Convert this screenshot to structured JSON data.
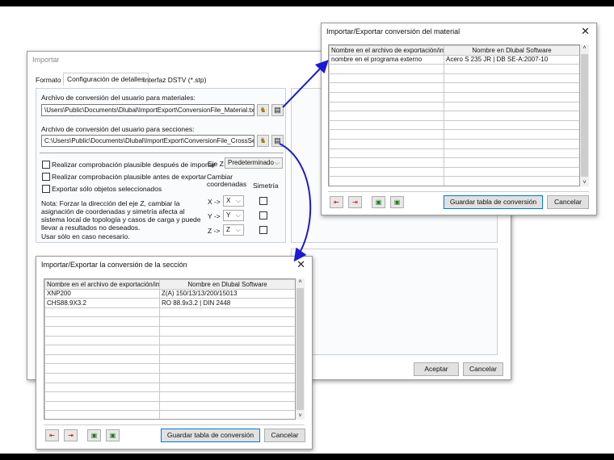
{
  "import_dialog": {
    "title": "Importar",
    "tabs": [
      "Formato",
      "Configuración de detalles",
      "Interfaz DSTV (*.stp)"
    ],
    "materials_label": "Archivo de conversión del usuario para materiales:",
    "materials_path": "\\Users\\Public\\Documents\\Dlubal\\ImportExport\\ConversionFile_Material.txt",
    "sections_label": "Archivo de conversión del usuario para secciones:",
    "sections_path": "C:\\Users\\Public\\Documents\\Dlubal\\ImportExport\\ConversionFile_CrossSect",
    "checks": [
      "Realizar comprobación plausible después de importar",
      "Realizar comprobación plausible antes de exportar",
      "Exportar sólo objetos seleccionados"
    ],
    "axis_z_label": "Eje Z:",
    "axis_z_value": "Predeterminado",
    "change_coords_label": "Cambiar coordenadas",
    "symmetry_label": "Simetría",
    "axes": [
      {
        "label": "X ->",
        "value": "X"
      },
      {
        "label": "Y ->",
        "value": "Y"
      },
      {
        "label": "Z ->",
        "value": "Z"
      }
    ],
    "note": "Nota: Forzar la dirección del eje Z, cambiar la asignación de coordenadas y simetría afecta al sistema local de topología y casos de carga y puede llevar a resultados no deseados.",
    "note2": "Usar sólo en caso necesario.",
    "ok": "Aceptar",
    "cancel": "Cancelar"
  },
  "material_dialog": {
    "title": "Importar/Exportar conversión del material",
    "columns": [
      "Nombre en el archivo de exportación/importación",
      "Nombre en Dlubal Software"
    ],
    "rows": [
      [
        "nombre en el programa externo",
        "Acero S 235 JR | DB SE-A:2007-10"
      ]
    ],
    "save": "Guardar tabla de conversión",
    "cancel": "Cancelar"
  },
  "section_dialog": {
    "title": "Importar/Exportar la conversión de la sección",
    "columns": [
      "Nombre en el archivo de exportación/importación",
      "Nombre en Dlubal Software"
    ],
    "rows": [
      [
        "XNP200",
        "Z(A) 150/13/13/200/15013"
      ],
      [
        "CHS88.9X3.2",
        "RO 88.9x3.2 | DIN 2448"
      ]
    ],
    "save": "Guardar tabla de conversión",
    "cancel": "Cancelar"
  },
  "colors": {
    "arrow": "#1a1ad6",
    "accent": "#0078d7"
  }
}
